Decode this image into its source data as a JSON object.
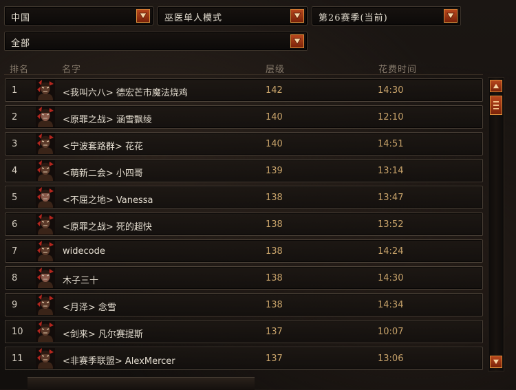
{
  "filters": {
    "region": "中国",
    "class_mode": "巫医单人模式",
    "season": "第26赛季(当前)",
    "scope": "全部"
  },
  "columns": {
    "rank": "排名",
    "name": "名字",
    "level": "层级",
    "time": "花费时间"
  },
  "rows": [
    {
      "rank": "1",
      "name": "<我叫六八> 德宏芒市魔法烧鸡",
      "level": "142",
      "time": "14:30",
      "portrait": "male"
    },
    {
      "rank": "2",
      "name": "<原罪之战> 涵雪飘绫",
      "level": "140",
      "time": "12:10",
      "portrait": "female"
    },
    {
      "rank": "3",
      "name": "<宁波套路群> 花花",
      "level": "140",
      "time": "14:51",
      "portrait": "male"
    },
    {
      "rank": "4",
      "name": "<萌新二会> 小四哥",
      "level": "139",
      "time": "13:14",
      "portrait": "male"
    },
    {
      "rank": "5",
      "name": "<不屈之地> Vanessa",
      "level": "138",
      "time": "13:47",
      "portrait": "female"
    },
    {
      "rank": "6",
      "name": "<原罪之战> 死的超快",
      "level": "138",
      "time": "13:52",
      "portrait": "male"
    },
    {
      "rank": "7",
      "name": "widecode",
      "level": "138",
      "time": "14:24",
      "portrait": "male"
    },
    {
      "rank": "8",
      "name": "木子三十",
      "level": "138",
      "time": "14:30",
      "portrait": "female"
    },
    {
      "rank": "9",
      "name": "<月泽> 念雪",
      "level": "138",
      "time": "14:34",
      "portrait": "male"
    },
    {
      "rank": "10",
      "name": "<剑来> 凡尔赛提斯",
      "level": "137",
      "time": "10:07",
      "portrait": "male"
    },
    {
      "rank": "11",
      "name": "<非赛季联盟> AlexMercer",
      "level": "137",
      "time": "13:06",
      "portrait": "male"
    }
  ],
  "colors": {
    "accent_button": "#b8471d",
    "level_time_text": "#c9a46b",
    "row_border": "#4b4137"
  },
  "icons": {
    "dropdown": "chevron-down-icon",
    "scroll_up": "arrow-up-icon",
    "scroll_down": "arrow-down-icon",
    "portrait": "witch-doctor-portrait-icon"
  }
}
